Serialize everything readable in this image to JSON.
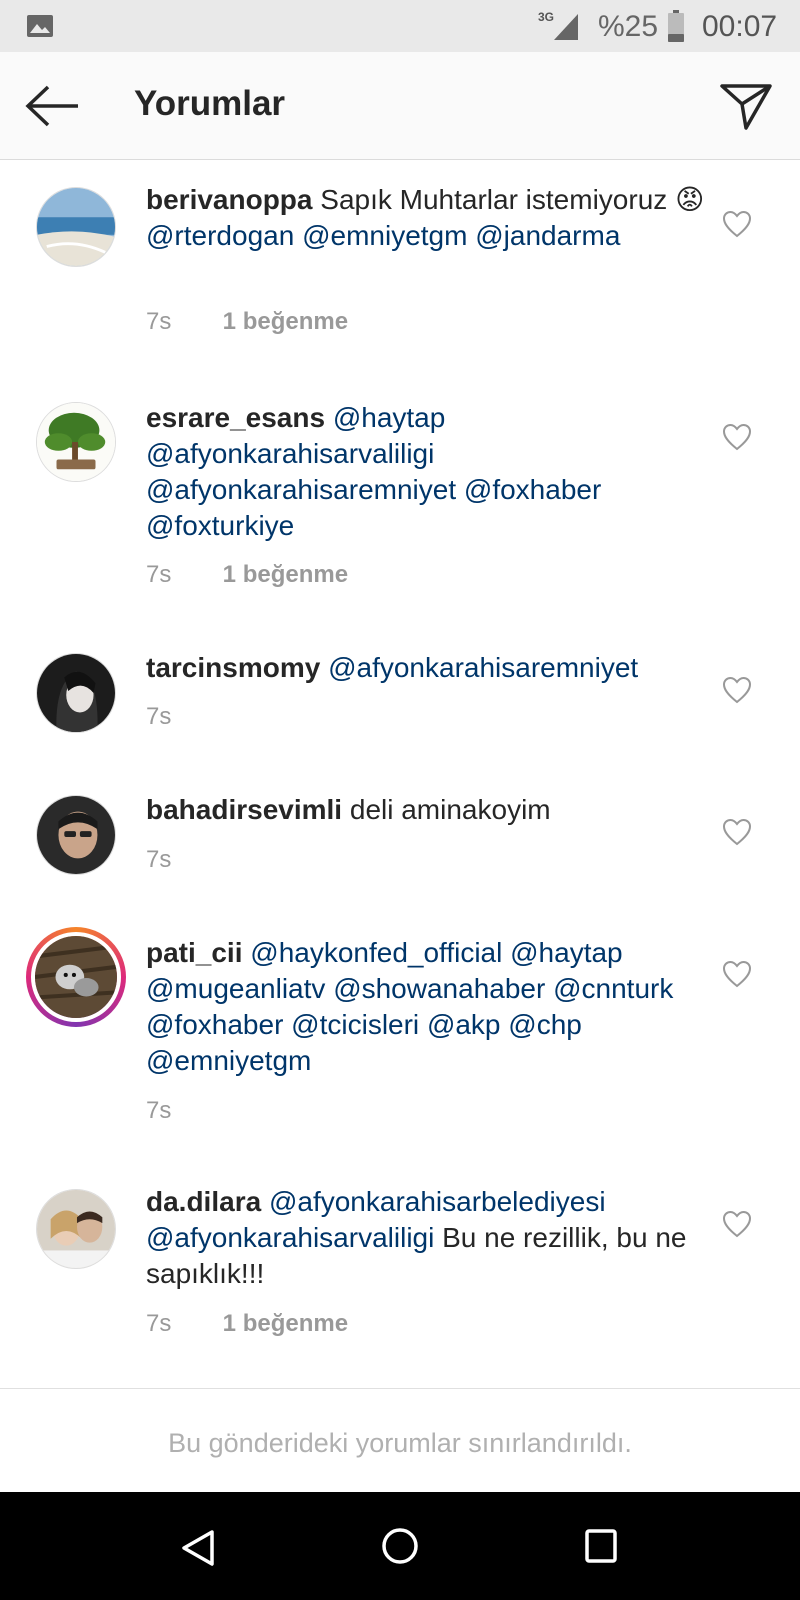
{
  "status_bar": {
    "network": "3G",
    "battery": "%25",
    "time": "00:07"
  },
  "header": {
    "title": "Yorumlar"
  },
  "comments": [
    {
      "username": "berivanoppa",
      "parts": [
        {
          "t": " Sapık Muhtarlar istemiyoruz "
        },
        {
          "t": "😡",
          "emoji": true
        },
        {
          "t": " "
        },
        {
          "t": "@rterdogan",
          "m": true
        },
        {
          "t": " "
        },
        {
          "t": "@emniyetgm",
          "m": true
        },
        {
          "t": " "
        },
        {
          "t": "@jandarma",
          "m": true
        }
      ],
      "time": "7s",
      "likes": "1 beğenme"
    },
    {
      "username": "esrare_esans",
      "parts": [
        {
          "t": " "
        },
        {
          "t": "@haytap",
          "m": true
        },
        {
          "t": " "
        },
        {
          "t": "@afyonkarahisarvaliligi",
          "m": true
        },
        {
          "t": " "
        },
        {
          "t": "@afyonkarahisaremniyet",
          "m": true
        },
        {
          "t": " "
        },
        {
          "t": "@foxhaber",
          "m": true
        },
        {
          "t": " "
        },
        {
          "t": "@foxturkiye",
          "m": true
        }
      ],
      "time": "7s",
      "likes": "1 beğenme"
    },
    {
      "username": "tarcinsmomy",
      "parts": [
        {
          "t": " "
        },
        {
          "t": "@afyonkarahisaremniyet",
          "m": true
        }
      ],
      "time": "7s",
      "likes": ""
    },
    {
      "username": "bahadirsevimli",
      "parts": [
        {
          "t": " deli aminakoyim"
        }
      ],
      "time": "7s",
      "likes": ""
    },
    {
      "username": "pati_cii",
      "parts": [
        {
          "t": " "
        },
        {
          "t": "@haykonfed_official",
          "m": true
        },
        {
          "t": " "
        },
        {
          "t": "@haytap",
          "m": true
        },
        {
          "t": " "
        },
        {
          "t": "@mugeanliatv",
          "m": true
        },
        {
          "t": "  "
        },
        {
          "t": "@showanahaber",
          "m": true
        },
        {
          "t": " "
        },
        {
          "t": "@cnnturk",
          "m": true
        },
        {
          "t": "  "
        },
        {
          "t": "@foxhaber",
          "m": true
        },
        {
          "t": "  "
        },
        {
          "t": "@tcicisleri",
          "m": true
        },
        {
          "t": "  "
        },
        {
          "t": "@akp",
          "m": true
        },
        {
          "t": " "
        },
        {
          "t": "@chp",
          "m": true
        },
        {
          "t": " "
        },
        {
          "t": "@emniyetgm",
          "m": true
        }
      ],
      "time": "7s",
      "likes": ""
    },
    {
      "username": "da.dilara",
      "parts": [
        {
          "t": " "
        },
        {
          "t": "@afyonkarahisarbelediyesi",
          "m": true
        },
        {
          "t": " "
        },
        {
          "t": "@afyonkarahisarvaliligi",
          "m": true
        },
        {
          "t": " Bu ne rezillik, bu ne sapıklık!!!"
        }
      ],
      "time": "7s",
      "likes": "1 beğenme"
    }
  ],
  "footer": {
    "restricted_text": "Bu gönderideki yorumlar sınırlandırıldı."
  },
  "icons": {
    "back": "arrow-left-icon",
    "send": "paper-plane-icon",
    "like": "heart-outline-icon",
    "nav": [
      "triangle-back-icon",
      "circle-home-icon",
      "square-recents-icon"
    ]
  },
  "colors": {
    "mention": "#003569",
    "meta": "#999999",
    "restricted": "#b0b0b0"
  }
}
